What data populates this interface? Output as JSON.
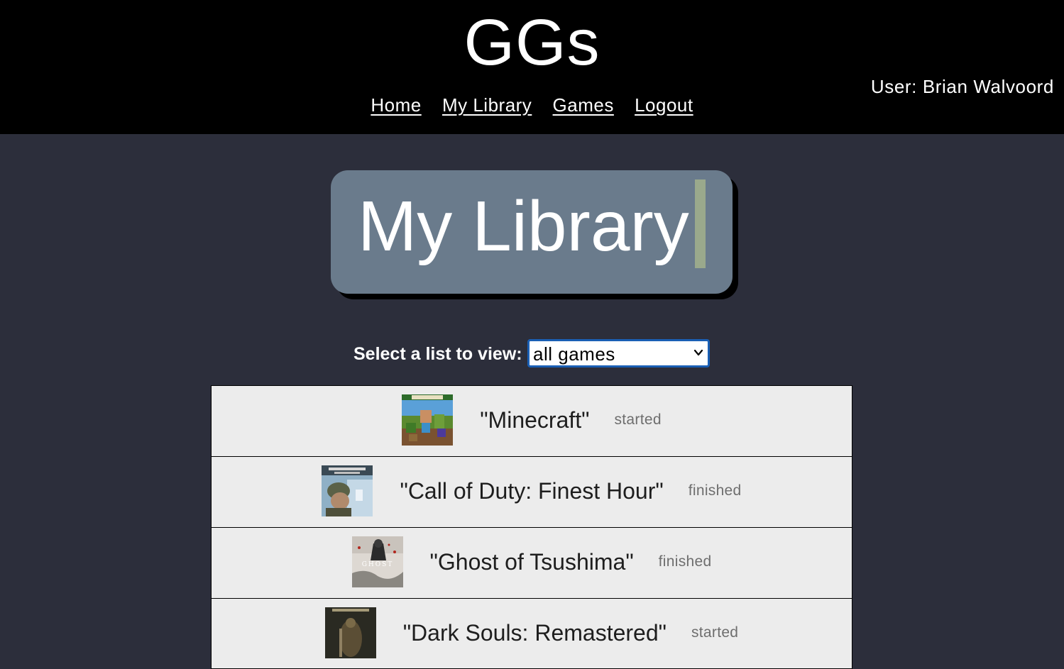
{
  "header": {
    "site_title": "GGs",
    "nav": [
      "Home",
      "My Library",
      "Games",
      "Logout"
    ],
    "user_label": "User: Brian Walvoord"
  },
  "page": {
    "title": "My Library"
  },
  "list_selector": {
    "label": "Select a list to view:",
    "selected": "all games"
  },
  "games": [
    {
      "title": "\"Minecraft\"",
      "status": "started",
      "cover_icon": "minecraft-cover-icon"
    },
    {
      "title": "\"Call of Duty: Finest Hour\"",
      "status": "finished",
      "cover_icon": "call-of-duty-cover-icon"
    },
    {
      "title": "\"Ghost of Tsushima\"",
      "status": "finished",
      "cover_icon": "ghost-of-tsushima-cover-icon"
    },
    {
      "title": "\"Dark Souls: Remastered\"",
      "status": "started",
      "cover_icon": "dark-souls-cover-icon"
    }
  ],
  "colors": {
    "header_bg": "#000000",
    "page_bg": "#2c2e3b",
    "title_card_bg": "#6a7b8c",
    "title_cursor": "#9aa98c",
    "row_bg": "#ececec",
    "select_focus": "#1a5fb4"
  }
}
